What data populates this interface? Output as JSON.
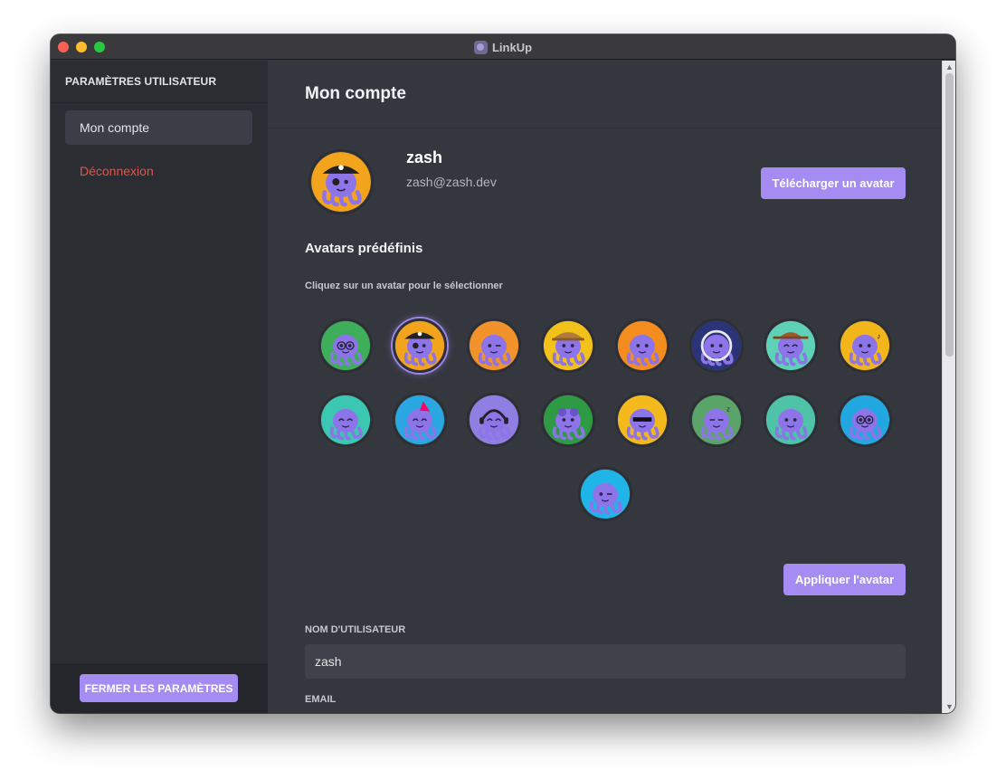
{
  "window": {
    "title": "LinkUp"
  },
  "sidebar": {
    "header": "PARAMÈTRES UTILISATEUR",
    "items": [
      {
        "label": "Mon compte",
        "active": true
      },
      {
        "label": "Déconnexion",
        "danger": true
      }
    ],
    "close_label": "FERMER LES PARAMÈTRES"
  },
  "main": {
    "title": "Mon compte",
    "profile": {
      "username": "zash",
      "email": "zash@zash.dev"
    },
    "upload_label": "Télécharger un avatar",
    "presets": {
      "title": "Avatars prédéfinis",
      "hint": "Cliquez sur un avatar pour le sélectionner",
      "avatars": [
        {
          "name": "glasses-tie",
          "bg": "#3fae5a",
          "selected": false
        },
        {
          "name": "pirate",
          "bg": "#f2a51c",
          "selected": true
        },
        {
          "name": "wink",
          "bg": "#f2922a",
          "selected": false
        },
        {
          "name": "explorer",
          "bg": "#f3c21a",
          "selected": false
        },
        {
          "name": "grumpy",
          "bg": "#f58c1e",
          "selected": false
        },
        {
          "name": "astronaut",
          "bg": "#2b3478",
          "selected": false
        },
        {
          "name": "cowboy",
          "bg": "#5fd1b7",
          "selected": false
        },
        {
          "name": "singer",
          "bg": "#f2b51a",
          "selected": false
        },
        {
          "name": "happy",
          "bg": "#3cc7b3",
          "selected": false
        },
        {
          "name": "party",
          "bg": "#2aa7e0",
          "selected": false
        },
        {
          "name": "headphones",
          "bg": "#8f7fe3",
          "selected": false
        },
        {
          "name": "frog",
          "bg": "#2e9a44",
          "selected": false
        },
        {
          "name": "sunglasses",
          "bg": "#f4b91d",
          "selected": false
        },
        {
          "name": "sleepy",
          "bg": "#5aa46a",
          "selected": false
        },
        {
          "name": "worried",
          "bg": "#4fc3a8",
          "selected": false
        },
        {
          "name": "nerd-cup",
          "bg": "#22a8e0",
          "selected": false
        },
        {
          "name": "wink-blue",
          "bg": "#1fb5e8",
          "selected": false
        }
      ]
    },
    "apply_label": "Appliquer l'avatar",
    "username_label": "NOM D'UTILISATEUR",
    "username_value": "zash",
    "email_label": "EMAIL"
  },
  "colors": {
    "accent": "#a48cf2",
    "danger": "#e0544a"
  }
}
